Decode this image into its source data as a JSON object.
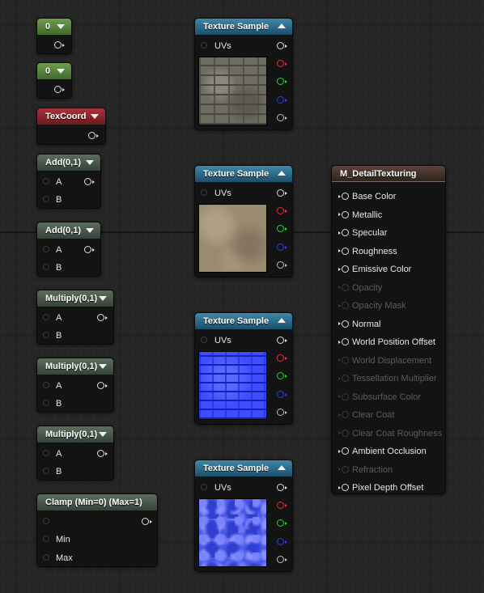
{
  "constants": [
    {
      "value": "0"
    },
    {
      "value": "0"
    }
  ],
  "texcoord": {
    "title": "TexCoord"
  },
  "math_nodes": [
    {
      "title": "Add(0,1)",
      "inputs": [
        "A",
        "B"
      ]
    },
    {
      "title": "Add(0,1)",
      "inputs": [
        "A",
        "B"
      ]
    },
    {
      "title": "Multiply(0,1)",
      "inputs": [
        "A",
        "B"
      ]
    },
    {
      "title": "Multiply(0,1)",
      "inputs": [
        "A",
        "B"
      ]
    },
    {
      "title": "Multiply(0,1)",
      "inputs": [
        "A",
        "B"
      ]
    }
  ],
  "clamp": {
    "title": "Clamp (Min=0) (Max=1)",
    "inputs": [
      "Min",
      "Max"
    ]
  },
  "texture_samples": [
    {
      "title": "Texture Sample",
      "input": "UVs",
      "preview": "stone-brick-icon"
    },
    {
      "title": "Texture Sample",
      "input": "UVs",
      "preview": "sand-icon"
    },
    {
      "title": "Texture Sample",
      "input": "UVs",
      "preview": "brick-normal-icon"
    },
    {
      "title": "Texture Sample",
      "input": "UVs",
      "preview": "noise-normal-icon"
    }
  ],
  "material": {
    "title": "M_DetailTexturing",
    "inputs": [
      {
        "label": "Base Color",
        "enabled": true
      },
      {
        "label": "Metallic",
        "enabled": true
      },
      {
        "label": "Specular",
        "enabled": true
      },
      {
        "label": "Roughness",
        "enabled": true
      },
      {
        "label": "Emissive Color",
        "enabled": true
      },
      {
        "label": "Opacity",
        "enabled": false
      },
      {
        "label": "Opacity Mask",
        "enabled": false
      },
      {
        "label": "Normal",
        "enabled": true
      },
      {
        "label": "World Position Offset",
        "enabled": true
      },
      {
        "label": "World Displacement",
        "enabled": false
      },
      {
        "label": "Tessellation Multiplier",
        "enabled": false
      },
      {
        "label": "Subsurface Color",
        "enabled": false
      },
      {
        "label": "Clear Coat",
        "enabled": false
      },
      {
        "label": "Clear Coat Roughness",
        "enabled": false
      },
      {
        "label": "Ambient Occlusion",
        "enabled": true
      },
      {
        "label": "Refraction",
        "enabled": false
      },
      {
        "label": "Pixel Depth Offset",
        "enabled": true
      }
    ]
  },
  "colors": {
    "constant_header": "#4f7f3a",
    "texcoord_header": "#8c2229",
    "texture_header": "#2a6a8c",
    "math_header": "#4a5c49",
    "material_header": "#4a3730",
    "channel_red": "#e53030",
    "channel_green": "#2fd02f",
    "channel_blue": "#2d3fe8"
  }
}
